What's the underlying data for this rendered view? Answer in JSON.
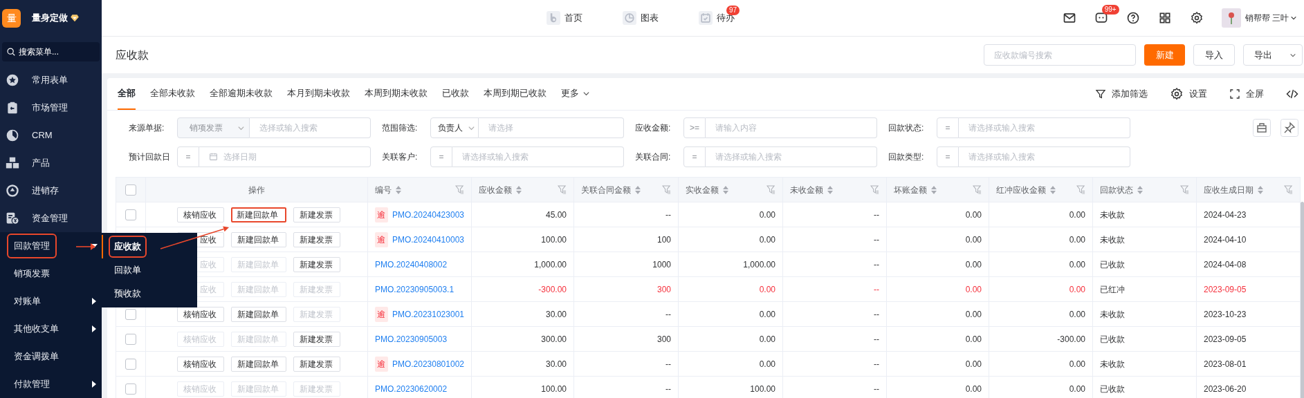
{
  "app": {
    "logo": "量",
    "name": "量身定做"
  },
  "sidebar": {
    "search_placeholder": "搜索菜单...",
    "items": [
      {
        "label": "常用表单",
        "kind": "star"
      },
      {
        "label": "市场管理",
        "kind": "clipboard"
      },
      {
        "label": "CRM",
        "kind": "pie"
      },
      {
        "label": "产品",
        "kind": "boxes"
      },
      {
        "label": "进销存",
        "kind": "cycle"
      },
      {
        "label": "资金管理",
        "kind": "funds",
        "children": [
          {
            "label": "回款管理",
            "circled": true,
            "expanded": true,
            "children": [
              {
                "label": "应收款",
                "selected": true,
                "circled": true
              },
              {
                "label": "回款单",
                "selected": false,
                "circled": false
              },
              {
                "label": "预收款",
                "selected": false,
                "circled": false
              }
            ]
          },
          {
            "label": "销项发票",
            "circled": false
          },
          {
            "label": "对账单",
            "circled": false,
            "expanded": false
          },
          {
            "label": "其他收支单",
            "circled": false,
            "expanded": false
          },
          {
            "label": "资金调拨单",
            "circled": false
          },
          {
            "label": "付款管理",
            "circled": false,
            "expanded": false
          }
        ]
      }
    ]
  },
  "top_nav": [
    {
      "label": "首页",
      "kind": "home"
    },
    {
      "label": "图表",
      "kind": "chart"
    },
    {
      "label": "待办",
      "kind": "todo",
      "badge": "97"
    }
  ],
  "header_icons": [
    {
      "kind": "mail"
    },
    {
      "kind": "chat",
      "badge": "99+"
    },
    {
      "kind": "help"
    },
    {
      "kind": "apps"
    },
    {
      "kind": "settings"
    }
  ],
  "user": {
    "name": "销帮帮 三叶"
  },
  "page": {
    "title": "应收款",
    "search_placeholder": "应收款编号搜索",
    "buttons": [
      {
        "label": "新建",
        "kind": "primary"
      },
      {
        "label": "导入",
        "kind": "default"
      },
      {
        "label": "导出",
        "kind": "dropdown"
      }
    ]
  },
  "tabs": [
    {
      "label": "全部",
      "selected": true
    },
    {
      "label": "全部未收款",
      "selected": false
    },
    {
      "label": "全部逾期未收款",
      "selected": false
    },
    {
      "label": "本月到期未收款",
      "selected": false
    },
    {
      "label": "本周到期未收款",
      "selected": false
    },
    {
      "label": "已收款",
      "selected": false
    },
    {
      "label": "本周到期已收款",
      "selected": false
    }
  ],
  "more_tab": "更多",
  "tools": [
    {
      "label": "添加筛选",
      "kind": "filter"
    },
    {
      "label": "设置",
      "kind": "settings"
    },
    {
      "label": "全屏",
      "kind": "fullscreen"
    },
    {
      "kind": "code"
    }
  ],
  "filters": [
    [
      {
        "label": "来源单据:",
        "operator": {
          "kind": "locked_select",
          "text": "销项发票"
        },
        "input": {
          "kind": "text",
          "placeholder": "选择或输入搜索"
        }
      },
      {
        "label": "范围筛选:",
        "operator": {
          "kind": "select",
          "text": "负责人"
        },
        "input": {
          "kind": "text",
          "placeholder": "请选择"
        }
      },
      {
        "label": "应收金额:",
        "operator": {
          "kind": "symbol",
          "text": ">="
        },
        "input": {
          "kind": "text",
          "placeholder": "请输入内容"
        }
      },
      {
        "label": "回款状态:",
        "operator": {
          "kind": "symbol",
          "text": "="
        },
        "input": {
          "kind": "text",
          "placeholder": "请选择或输入搜索"
        }
      }
    ],
    [
      {
        "label": "预计回款日",
        "operator": {
          "kind": "symbol",
          "text": "="
        },
        "input": {
          "kind": "date",
          "placeholder": "选择日期"
        }
      },
      {
        "label": "关联客户:",
        "operator": {
          "kind": "symbol",
          "text": "="
        },
        "input": {
          "kind": "text",
          "placeholder": "请选择或输入搜索"
        }
      },
      {
        "label": "关联合同:",
        "operator": {
          "kind": "symbol",
          "text": "="
        },
        "input": {
          "kind": "text",
          "placeholder": "请选择或输入搜索"
        }
      },
      {
        "label": "回款类型:",
        "operator": {
          "kind": "symbol",
          "text": "="
        },
        "input": {
          "kind": "text",
          "placeholder": "请选择或输入搜索"
        }
      }
    ]
  ],
  "table": {
    "columns": [
      {
        "kind": "checkbox",
        "checked": false
      },
      {
        "label": "操作",
        "kind": "actions"
      },
      {
        "label": "编号",
        "kind": "number"
      },
      {
        "label": "应收金额",
        "kind": "amount"
      },
      {
        "label": "关联合同金额",
        "kind": "amount"
      },
      {
        "label": "实收金额",
        "kind": "amount"
      },
      {
        "label": "未收金额",
        "kind": "amount"
      },
      {
        "label": "坏账金额",
        "kind": "amount"
      },
      {
        "label": "红冲应收金额",
        "kind": "amount"
      },
      {
        "label": "回款状态",
        "kind": "status"
      },
      {
        "label": "应收生成日期",
        "kind": "date"
      }
    ],
    "rows": [
      {
        "reversed": false,
        "cells": [
          {
            "checked": false
          },
          {
            "actions": [
              {
                "label": "核销应收",
                "disabled": false,
                "circled": false
              },
              {
                "label": "新建回款单",
                "disabled": false,
                "circled": true
              },
              {
                "label": "新建发票",
                "disabled": false,
                "circled": false
              }
            ]
          },
          {
            "tag": "逾",
            "text": "PMO.20240423003"
          },
          "45.00",
          "--",
          "0.00",
          "--",
          "0.00",
          "0.00",
          "未收款",
          "2024-04-23"
        ]
      },
      {
        "reversed": false,
        "cells": [
          "",
          {
            "actions": [
              {
                "label": "应收",
                "disabled": false,
                "circled": false
              },
              {
                "label": "新建回款单",
                "disabled": false,
                "circled": false
              },
              {
                "label": "新建发票",
                "disabled": false,
                "circled": false
              }
            ]
          },
          {
            "tag": "逾",
            "text": "PMO.20240410003"
          },
          "100.00",
          "100",
          "0.00",
          "--",
          "0.00",
          "0.00",
          "未收款",
          "2024-04-10"
        ]
      },
      {
        "reversed": false,
        "cells": [
          "",
          {
            "actions": [
              {
                "label": "应收",
                "disabled": true,
                "circled": false
              },
              {
                "label": "新建回款单",
                "disabled": true,
                "circled": false
              },
              {
                "label": "新建发票",
                "disabled": false,
                "circled": false
              }
            ]
          },
          {
            "text": "PMO.20240408002"
          },
          "1,000.00",
          "1000",
          "1,000.00",
          "--",
          "0.00",
          "0.00",
          "已收款",
          "2024-04-08"
        ]
      },
      {
        "reversed": true,
        "cells": [
          "",
          {
            "actions": [
              {
                "label": "应收",
                "disabled": true,
                "circled": false
              },
              {
                "label": "新建回款单",
                "disabled": true,
                "circled": false
              },
              {
                "label": "新建发票",
                "disabled": true,
                "circled": false
              }
            ]
          },
          {
            "text": "PMO.20230905003.1"
          },
          "-300.00",
          "300",
          "0.00",
          "--",
          "0.00",
          "0.00",
          "已红冲",
          "2023-09-05"
        ]
      },
      {
        "reversed": false,
        "cells": [
          {
            "checked": false
          },
          {
            "actions": [
              {
                "label": "核销应收",
                "disabled": false,
                "circled": false
              },
              {
                "label": "新建回款单",
                "disabled": false,
                "circled": false
              },
              {
                "label": "新建发票",
                "disabled": true,
                "circled": false
              }
            ]
          },
          {
            "tag": "逾",
            "text": "PMO.20231023001"
          },
          "30.00",
          "--",
          "0.00",
          "--",
          "0.00",
          "0.00",
          "未收款",
          "2023-10-23"
        ]
      },
      {
        "reversed": false,
        "cells": [
          {
            "checked": false
          },
          {
            "actions": [
              {
                "label": "核销应收",
                "disabled": true,
                "circled": false
              },
              {
                "label": "新建回款单",
                "disabled": true,
                "circled": false
              },
              {
                "label": "新建发票",
                "disabled": false,
                "circled": false
              }
            ]
          },
          {
            "text": "PMO.20230905003"
          },
          "300.00",
          "300",
          "0.00",
          "--",
          "0.00",
          "-300.00",
          "已收款",
          "2023-09-05"
        ]
      },
      {
        "reversed": false,
        "cells": [
          {
            "checked": false
          },
          {
            "actions": [
              {
                "label": "核销应收",
                "disabled": false,
                "circled": false
              },
              {
                "label": "新建回款单",
                "disabled": false,
                "circled": false
              },
              {
                "label": "新建发票",
                "disabled": false,
                "circled": false
              }
            ]
          },
          {
            "tag": "逾",
            "text": "PMO.20230801002"
          },
          "30.00",
          "--",
          "0.00",
          "--",
          "0.00",
          "0.00",
          "未收款",
          "2023-08-01"
        ]
      },
      {
        "reversed": false,
        "cells": [
          {
            "checked": false
          },
          {
            "actions": [
              {
                "label": "核销应收",
                "disabled": true,
                "circled": false
              },
              {
                "label": "新建回款单",
                "disabled": true,
                "circled": false
              },
              {
                "label": "新建发票",
                "disabled": true,
                "circled": false
              }
            ]
          },
          {
            "text": "PMO.20230620002"
          },
          "100.00",
          "--",
          "100.00",
          "--",
          "0.00",
          "0.00",
          "已收款",
          "2023-06-20"
        ]
      }
    ]
  }
}
